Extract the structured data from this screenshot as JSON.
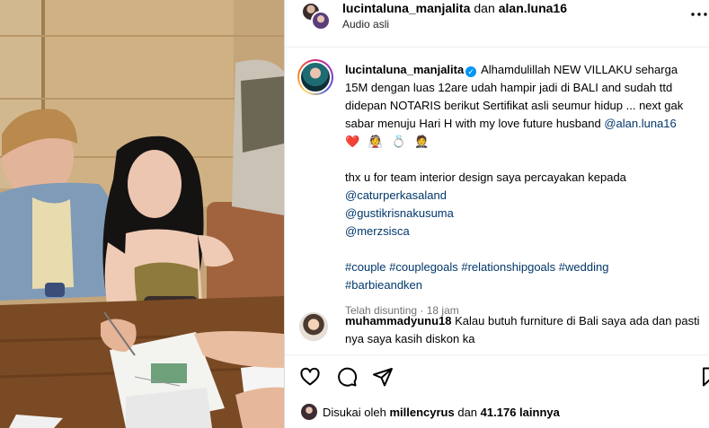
{
  "header": {
    "user1": "lucintaluna_manjalita",
    "connector": "dan",
    "user2": "alan.luna16",
    "audio": "Audio asli",
    "more_icon": "more-horizontal-icon"
  },
  "caption": {
    "username": "lucintaluna_manjalita",
    "verified_icon": "verified-badge-icon",
    "text1": "Alhamdulillah NEW VILLAKU seharga 15M dengan luas 12are udah hampir jadi di BALI and sudah ttd didepan NOTARIS berikut Sertifikat asli seumur hidup ... next gak sabar menuju Hari H with my love future husband",
    "mention_alan": "@alan.luna16",
    "emojis": "❤️ 👰 💍 🤵",
    "text2": "thx u for team interior design saya percayakan kepada",
    "mention1": "@caturperkasaland",
    "mention2": "@gustikrisnakusuma",
    "mention3": "@merzsisca",
    "hashtags_line1": "#couple #couplegoals #relationshipgoals #wedding",
    "hashtags_line2": "#barbieandken",
    "meta": "Telah disunting · 18 jam"
  },
  "comment": {
    "username": "muhammadyunu18",
    "text": "Kalau butuh furniture di Bali saya ada dan pasti nya saya kasih diskon ka"
  },
  "actions": {
    "like_icon": "heart-icon",
    "comment_icon": "comment-icon",
    "share_icon": "send-icon",
    "save_icon": "bookmark-icon"
  },
  "likes": {
    "prefix": "Disukai oleh",
    "user": "millencyrus",
    "connector": "dan",
    "count": "41.176 lainnya"
  }
}
